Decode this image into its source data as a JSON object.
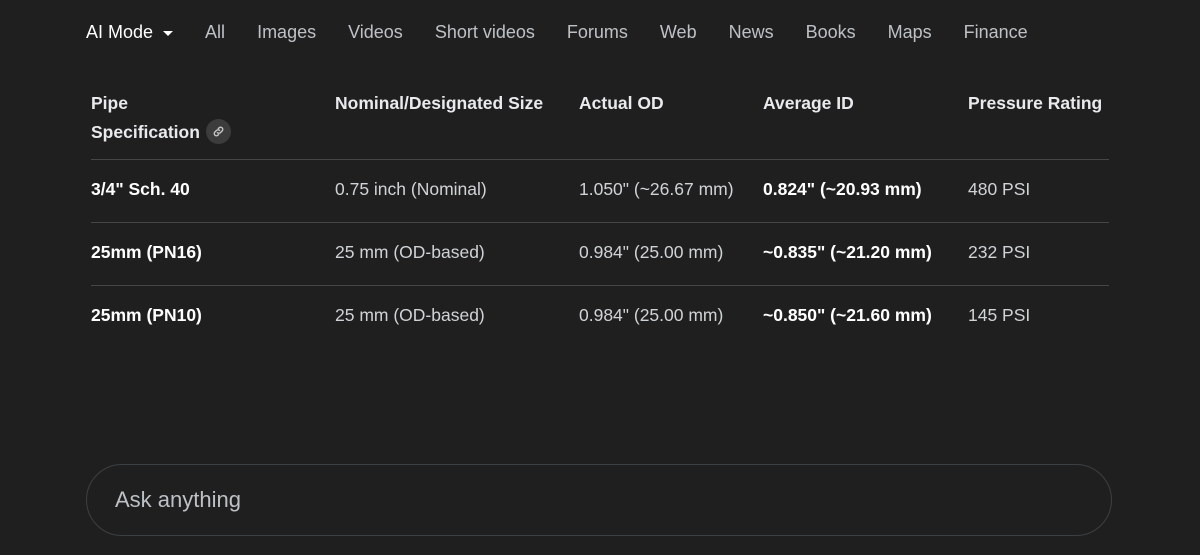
{
  "nav": {
    "tabs": [
      {
        "label": "AI Mode",
        "active": true
      },
      {
        "label": "All"
      },
      {
        "label": "Images"
      },
      {
        "label": "Videos"
      },
      {
        "label": "Short videos"
      },
      {
        "label": "Forums"
      },
      {
        "label": "Web"
      },
      {
        "label": "News"
      },
      {
        "label": "Books"
      },
      {
        "label": "Maps"
      },
      {
        "label": "Finance"
      }
    ]
  },
  "table": {
    "headers": {
      "col1_line1": "Pipe",
      "col1_line2": "Specification",
      "col2": "Nominal/Designated Size",
      "col3": "Actual OD",
      "col4": "Average ID",
      "col5": "Pressure Rating"
    },
    "rows": [
      {
        "spec": "3/4\" Sch. 40",
        "size": "0.75 inch (Nominal)",
        "od": "1.050\" (~26.67 mm)",
        "id": "0.824\" (~20.93 mm)",
        "pressure": "480 PSI"
      },
      {
        "spec": "25mm (PN16)",
        "size": "25 mm (OD-based)",
        "od": "0.984\" (25.00 mm)",
        "id": "~0.835\" (~21.20 mm)",
        "pressure": "232 PSI"
      },
      {
        "spec": "25mm (PN10)",
        "size": "25 mm (OD-based)",
        "od": "0.984\" (25.00 mm)",
        "id": "~0.850\" (~21.60 mm)",
        "pressure": "145 PSI"
      }
    ]
  },
  "ask": {
    "placeholder": "Ask anything"
  },
  "icons": {
    "dropdown": "caret-down-icon",
    "link": "link-icon"
  }
}
